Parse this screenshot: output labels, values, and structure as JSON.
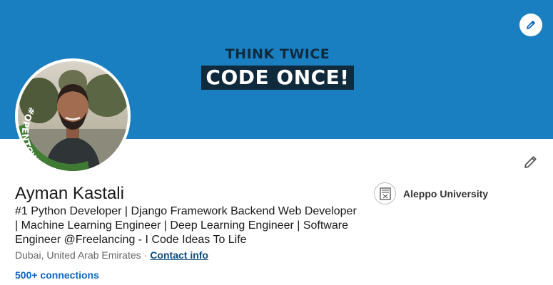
{
  "banner": {
    "line1": "THINK TWICE",
    "line2": "CODE ONCE!",
    "background_color": "#1a7fc1",
    "edit_icon": "pencil-icon"
  },
  "avatar": {
    "badge_text": "#OPENTOWORK",
    "badge_color": "#2e7d32"
  },
  "profile": {
    "name": "Ayman Kastali",
    "headline": "#1 Python Developer | Django Framework Backend Web Developer | Machine Learning Engineer | Deep Learning Engineer | Software Engineer @Freelancing - I Code Ideas To Life",
    "location": "Dubai, United Arab Emirates",
    "separator": "·",
    "contact_info": "Contact info",
    "connections": "500+ connections",
    "edit_icon": "pencil-icon"
  },
  "education": {
    "name": "Aleppo University",
    "logo_icon": "university-logo-icon"
  }
}
